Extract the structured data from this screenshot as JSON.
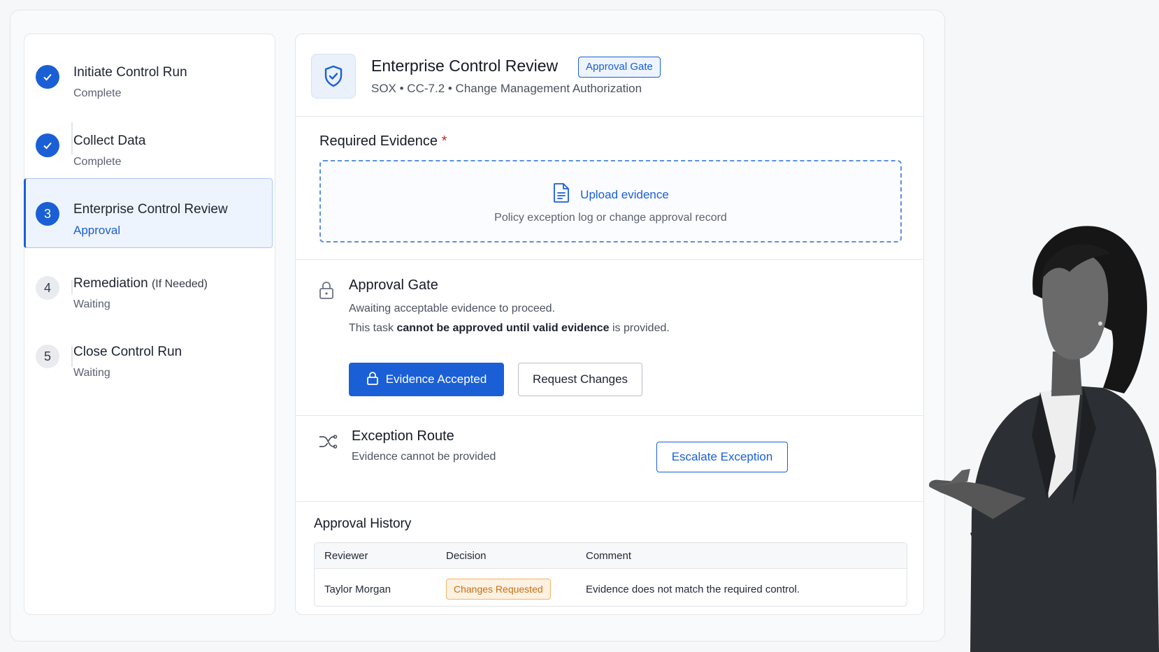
{
  "steps": [
    {
      "number": "1",
      "title": "Initiate Control Run",
      "title_suffix": "",
      "status": "Complete",
      "state": "done"
    },
    {
      "number": "2",
      "title": "Collect Data",
      "title_suffix": "",
      "status": "Complete",
      "state": "done"
    },
    {
      "number": "3",
      "title": "Enterprise Control Review",
      "title_suffix": "",
      "status": "Approval",
      "state": "active"
    },
    {
      "number": "4",
      "title": "Remediation",
      "title_suffix": "(If Needed)",
      "status": "Waiting",
      "state": "waiting"
    },
    {
      "number": "5",
      "title": "Close Control Run",
      "title_suffix": "",
      "status": "Waiting",
      "state": "waiting"
    }
  ],
  "header": {
    "title": "Enterprise Control Review",
    "badge": "Approval Gate",
    "subtitle": "SOX • CC-7.2 • Change Management Authorization",
    "icon": "shield-check-icon"
  },
  "evidence": {
    "label": "Required Evidence",
    "required_mark": "*",
    "upload_link": "Upload evidence",
    "hint": "Policy exception log or change approval record",
    "icon": "document-icon"
  },
  "gate": {
    "title": "Approval Gate",
    "line1": "Awaiting acceptable evidence to proceed.",
    "line2_prefix": "This task ",
    "line2_bold": "cannot be approved until valid evidence",
    "line2_suffix": " is provided.",
    "accept_button": "Evidence Accepted",
    "request_button": "Request Changes",
    "icon": "lock-icon"
  },
  "exception": {
    "title": "Exception Route",
    "subtitle": "Evidence cannot be provided",
    "button": "Escalate Exception",
    "icon": "shuffle-route-icon"
  },
  "history": {
    "title": "Approval History",
    "columns": [
      "Reviewer",
      "Decision",
      "Comment"
    ],
    "rows": [
      {
        "reviewer": "Taylor Morgan",
        "decision": "Changes Requested",
        "comment": "Evidence does not match the required control."
      }
    ]
  },
  "colors": {
    "accent": "#1a5fd6",
    "warning": "#c96f12",
    "required": "#c62a2a"
  }
}
